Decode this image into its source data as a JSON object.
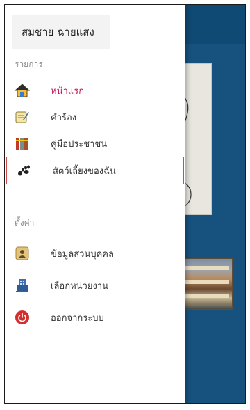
{
  "user": {
    "name": "สมชาย  ฉายแสง"
  },
  "menu": {
    "section_title": "รายการ",
    "items": [
      {
        "label": "หน้าแรก",
        "icon": "home-icon",
        "active": true
      },
      {
        "label": "คำร้อง",
        "icon": "edit-document-icon"
      },
      {
        "label": "คู่มือประชาชน",
        "icon": "books-icon"
      },
      {
        "label": "สัตว์เลี้ยงของฉัน",
        "icon": "paw-icon",
        "selected": true
      }
    ]
  },
  "settings": {
    "section_title": "ตั้งค่า",
    "items": [
      {
        "label": "ข้อมูลส่วนบุคคล",
        "icon": "contact-card-icon"
      },
      {
        "label": "เลือกหน่วยงาน",
        "icon": "building-icon"
      },
      {
        "label": "ออกจากระบบ",
        "icon": "power-icon"
      }
    ]
  },
  "colors": {
    "active_text": "#c2185b",
    "selected_border": "#d24a4a",
    "background_app": "#17527e"
  }
}
